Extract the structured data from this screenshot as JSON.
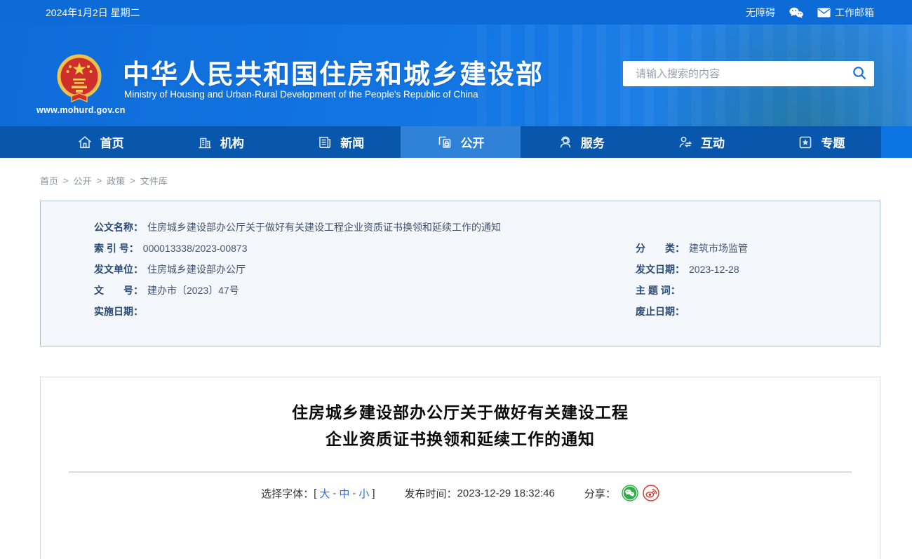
{
  "topbar": {
    "date": "2024年1月2日 星期二",
    "accessibility": "无障碍",
    "mailbox": "工作邮箱"
  },
  "header": {
    "site_title": "中华人民共和国住房和城乡建设部",
    "site_subtitle": "Ministry of Housing and Urban-Rural Development of the People's Republic of China",
    "site_url": "www.mohurd.gov.cn",
    "search_placeholder": "请输入搜索的内容"
  },
  "nav": {
    "items": [
      {
        "label": "首页",
        "icon": "home-icon",
        "active": false
      },
      {
        "label": "机构",
        "icon": "organization-icon",
        "active": false
      },
      {
        "label": "新闻",
        "icon": "news-icon",
        "active": false
      },
      {
        "label": "公开",
        "icon": "disclosure-icon",
        "active": true
      },
      {
        "label": "服务",
        "icon": "service-icon",
        "active": false
      },
      {
        "label": "互动",
        "icon": "interaction-icon",
        "active": false
      },
      {
        "label": "专题",
        "icon": "topics-icon",
        "active": false
      }
    ]
  },
  "breadcrumb": {
    "items": [
      "首页",
      "公开",
      "政策",
      "文件库"
    ],
    "separator": ">"
  },
  "doc_info": {
    "title_label": "公文名称：",
    "title_value": "住房城乡建设部办公厅关于做好有关建设工程企业资质证书换领和延续工作的通知",
    "index_label": "索 引 号：",
    "index_value": "000013338/2023-00873",
    "unit_label": "发文单位：",
    "unit_value": "住房城乡建设部办公厅",
    "docnum_label": "文　　号：",
    "docnum_value": "建办市〔2023〕47号",
    "impl_label": "实施日期：",
    "impl_value": "",
    "class_label": "分　　类：",
    "class_value": "建筑市场监管",
    "pubdate_label": "发文日期：",
    "pubdate_value": "2023-12-28",
    "subject_label": "主 题 词：",
    "subject_value": "",
    "repeal_label": "废止日期：",
    "repeal_value": ""
  },
  "article": {
    "title_line1": "住房城乡建设部办公厅关于做好有关建设工程",
    "title_line2": "企业资质证书换领和延续工作的通知",
    "font_label": "选择字体：",
    "bracket_open": "[",
    "bracket_close": "]",
    "dash": "-",
    "font_sizes": [
      "大",
      "中",
      "小"
    ],
    "publish_label": "发布时间：",
    "publish_time": "2023-12-29 18:32:46",
    "share_label": "分享："
  },
  "colors": {
    "topbar_blue": "#0d6bd7",
    "header_blue": "#1377e4",
    "nav_blue": "#0857ad",
    "nav_active_blue": "#2f82d8",
    "info_panel_bg": "#f4f8fd",
    "info_panel_border": "#a9bed2",
    "link_blue": "#2b6bd3",
    "wechat_green": "#2fae47",
    "weibo_red": "#d8332a"
  }
}
